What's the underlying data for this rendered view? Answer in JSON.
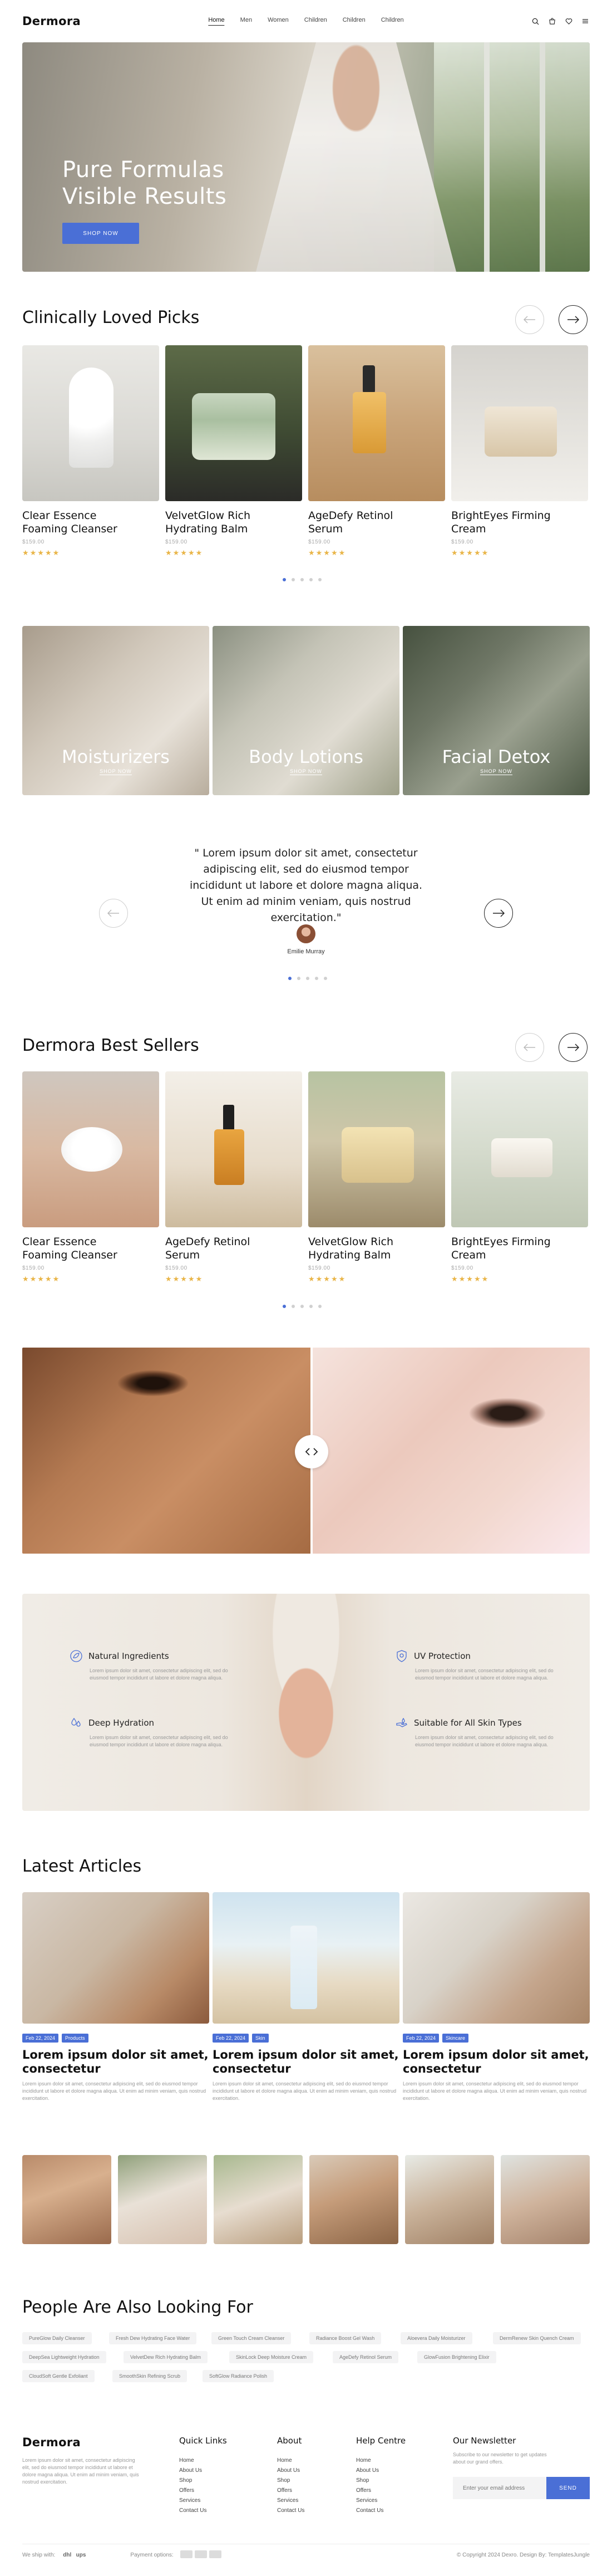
{
  "brand": "Dermora",
  "nav": [
    "Home",
    "Men",
    "Women",
    "Children",
    "Children",
    "Children"
  ],
  "hero": {
    "title_line1": "Pure Formulas",
    "title_line2": "Visible Results",
    "button": "SHOP NOW"
  },
  "section_clinical": {
    "title": "Clinically Loved Picks"
  },
  "clinical_products": [
    {
      "name_l1": "Clear Essence",
      "name_l2": "Foaming Cleanser",
      "price": "$159.00",
      "stars": "★★★★★"
    },
    {
      "name_l1": "VelvetGlow Rich",
      "name_l2": "Hydrating Balm",
      "price": "$159.00",
      "stars": "★★★★★"
    },
    {
      "name_l1": "AgeDefy Retinol",
      "name_l2": "Serum",
      "price": "$159.00",
      "stars": "★★★★★"
    },
    {
      "name_l1": "BrightEyes Firming",
      "name_l2": "Cream",
      "price": "$159.00",
      "stars": "★★★★★"
    }
  ],
  "categories": [
    {
      "name": "Moisturizers",
      "shop": "SHOP NOW"
    },
    {
      "name": "Body Lotions",
      "shop": "SHOP NOW"
    },
    {
      "name": "Facial Detox",
      "shop": "SHOP NOW"
    }
  ],
  "testimonial": {
    "quote": "\" Lorem ipsum dolor sit amet, consectetur adipiscing elit, sed do eiusmod tempor incididunt ut labore et dolore magna aliqua. Ut enim ad minim veniam, quis nostrud exercitation.\"",
    "author": "Emilie Murray"
  },
  "section_bestsellers": {
    "title": "Dermora Best Sellers"
  },
  "bestseller_products": [
    {
      "name_l1": "Clear Essence",
      "name_l2": "Foaming Cleanser",
      "price": "$159.00",
      "stars": "★★★★★"
    },
    {
      "name_l1": "AgeDefy Retinol",
      "name_l2": "Serum",
      "price": "$159.00",
      "stars": "★★★★★"
    },
    {
      "name_l1": "VelvetGlow Rich",
      "name_l2": "Hydrating Balm",
      "price": "$159.00",
      "stars": "★★★★★"
    },
    {
      "name_l1": "BrightEyes Firming",
      "name_l2": "Cream",
      "price": "$159.00",
      "stars": "★★★★★"
    }
  ],
  "features": [
    {
      "title": "Natural Ingredients",
      "desc": "Lorem ipsum dolor sit amet, consectetur adipiscing elit, sed do eiusmod tempor incididunt ut labore et dolore magna aliqua."
    },
    {
      "title": "Deep Hydration",
      "desc": "Lorem ipsum dolor sit amet, consectetur adipiscing elit, sed do eiusmod tempor incididunt ut labore et dolore magna aliqua."
    },
    {
      "title": "UV Protection",
      "desc": "Lorem ipsum dolor sit amet, consectetur adipiscing elit, sed do eiusmod tempor incididunt ut labore et dolore magna aliqua."
    },
    {
      "title": "Suitable for All Skin Types",
      "desc": "Lorem ipsum dolor sit amet, consectetur adipiscing elit, sed do eiusmod tempor incididunt ut labore et dolore magna aliqua."
    }
  ],
  "section_articles": {
    "title": "Latest Articles"
  },
  "articles": [
    {
      "date": "Feb 22, 2024",
      "tag": "Products",
      "title_l1": "Lorem ipsum dolor sit amet,",
      "title_l2": "consectetur",
      "desc": "Lorem ipsum dolor sit amet, consectetur adipiscing elit, sed do eiusmod tempor incididunt ut labore et dolore magna aliqua. Ut enim ad minim veniam, quis nostrud exercitation."
    },
    {
      "date": "Feb 22, 2024",
      "tag": "Skin",
      "title_l1": "Lorem ipsum dolor sit amet,",
      "title_l2": "consectetur",
      "desc": "Lorem ipsum dolor sit amet, consectetur adipiscing elit, sed do eiusmod tempor incididunt ut labore et dolore magna aliqua. Ut enim ad minim veniam, quis nostrud exercitation."
    },
    {
      "date": "Feb 22, 2024",
      "tag": "Skincare",
      "title_l1": "Lorem ipsum dolor sit amet,",
      "title_l2": "consectetur",
      "desc": "Lorem ipsum dolor sit amet, consectetur adipiscing elit, sed do eiusmod tempor incididunt ut labore et dolore magna aliqua. Ut enim ad minim veniam, quis nostrud exercitation."
    }
  ],
  "section_people": {
    "title": "People Are Also Looking For"
  },
  "people_chips": [
    "PureGlow Daily Cleanser",
    "Fresh Dew Hydrating Face Water",
    "Green Touch Cream Cleanser",
    "Radiance Boost Gel Wash",
    "Aloevera Daily Moisturizer",
    "DermRenew Skin Quench Cream",
    "DeepSea Lightweight Hydration",
    "VelvetDew Rich Hydrating Balm",
    "SkinLock Deep Moisture Cream",
    "AgeDefy Retinol Serum",
    "GlowFusion Brightening Elixir",
    "CloudSoft Gentle Exfoliant",
    "SmoothSkin Refining Scrub",
    "SoftGlow Radiance Polish"
  ],
  "footer": {
    "about_text": "Lorem ipsum dolor sit amet, consectetur adipiscing elit, sed do eiusmod tempor incididunt ut labore et dolore magna aliqua. Ut enim ad minim veniam, quis nostrud exercitation.",
    "columns": [
      {
        "title": "Quick Links",
        "links": [
          "Home",
          "About Us",
          "Shop",
          "Offers",
          "Services",
          "Contact Us"
        ]
      },
      {
        "title": "About",
        "links": [
          "Home",
          "About Us",
          "Shop",
          "Offers",
          "Services",
          "Contact Us"
        ]
      },
      {
        "title": "Help Centre",
        "links": [
          "Home",
          "About Us",
          "Shop",
          "Offers",
          "Services",
          "Contact Us"
        ]
      }
    ],
    "newsletter_title": "Our Newsletter",
    "newsletter_text": "Subscribe to our newsletter to get updates about our grand offers.",
    "email_placeholder": "Enter your email address",
    "send": "SEND",
    "we_ship": "We ship with:",
    "payment": "Payment options:",
    "copyright": "© Copyright 2024 Dexro. Design By: TemplatesJungle"
  },
  "colors": {
    "accent": "#4a6fd6",
    "star": "#e9b548"
  }
}
